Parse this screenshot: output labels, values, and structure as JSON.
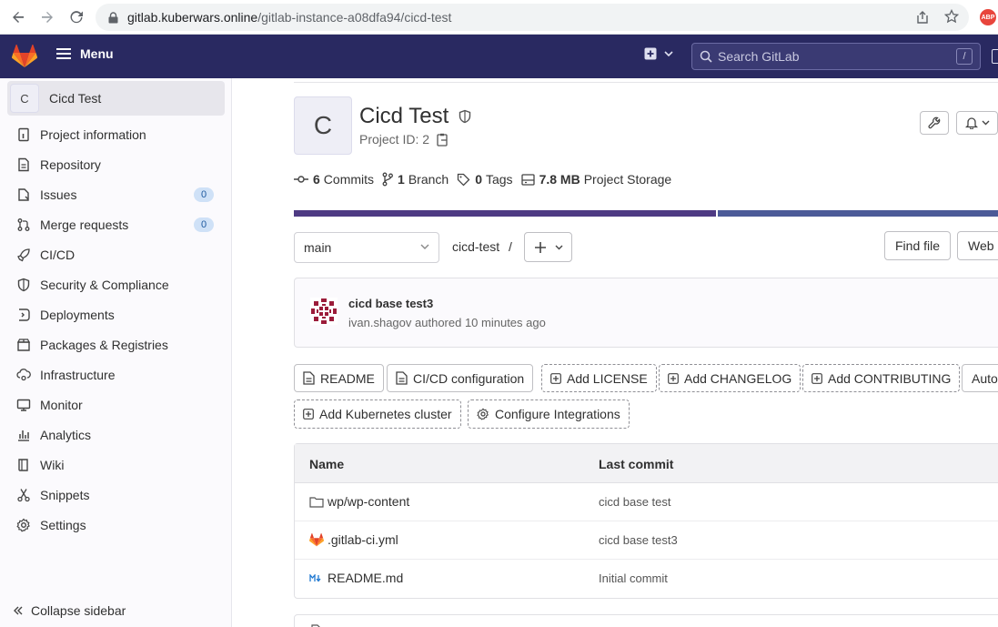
{
  "browser": {
    "url_host": "gitlab.kuberwars.online",
    "url_path": "/gitlab-instance-a08dfa94/cicd-test",
    "abp_label": "ABP"
  },
  "topnav": {
    "menu_label": "Menu",
    "search_placeholder": "Search GitLab",
    "search_shortcut": "/"
  },
  "sidebar": {
    "context_avatar": "C",
    "context_name": "Cicd Test",
    "items": [
      {
        "label": "Project information",
        "icon": "info-icon"
      },
      {
        "label": "Repository",
        "icon": "document-icon"
      },
      {
        "label": "Issues",
        "icon": "issues-icon",
        "count": "0"
      },
      {
        "label": "Merge requests",
        "icon": "merge-request-icon",
        "count": "0"
      },
      {
        "label": "CI/CD",
        "icon": "rocket-icon"
      },
      {
        "label": "Security & Compliance",
        "icon": "shield-icon"
      },
      {
        "label": "Deployments",
        "icon": "deployments-icon"
      },
      {
        "label": "Packages & Registries",
        "icon": "package-icon"
      },
      {
        "label": "Infrastructure",
        "icon": "cloud-gear-icon"
      },
      {
        "label": "Monitor",
        "icon": "monitor-icon"
      },
      {
        "label": "Analytics",
        "icon": "chart-icon"
      },
      {
        "label": "Wiki",
        "icon": "book-icon"
      },
      {
        "label": "Snippets",
        "icon": "scissors-icon"
      },
      {
        "label": "Settings",
        "icon": "gear-icon"
      }
    ],
    "collapse_label": "Collapse sidebar"
  },
  "project": {
    "avatar": "C",
    "title": "Cicd Test",
    "id_label": "Project ID: 2",
    "stats": {
      "commits_count": "6",
      "commits_label": "Commits",
      "branch_count": "1",
      "branch_label": "Branch",
      "tags_count": "0",
      "tags_label": "Tags",
      "storage_size": "7.8 MB",
      "storage_label": "Project Storage"
    }
  },
  "repo": {
    "branch": "main",
    "path": "cicd-test",
    "path_sep": "/",
    "find_file_label": "Find file",
    "web_ide_label": "Web"
  },
  "last_commit": {
    "title": "cicd base test3",
    "author": "ivan.shagov",
    "time_text": "authored 10 minutes ago"
  },
  "quick_actions": {
    "readme": "README",
    "cicd_config": "CI/CD configuration",
    "add_license": "Add LICENSE",
    "add_changelog": "Add CHANGELOG",
    "add_contributing": "Add CONTRIBUTING",
    "auto_devops": "Auto",
    "add_kubernetes": "Add Kubernetes cluster",
    "configure_integrations": "Configure Integrations"
  },
  "file_table": {
    "col_name": "Name",
    "col_last_commit": "Last commit",
    "rows": [
      {
        "name": "wp/wp-content",
        "commit": "cicd base test",
        "icon": "folder-icon"
      },
      {
        "name": ".gitlab-ci.yml",
        "commit": "cicd base test3",
        "icon": "gitlab-icon"
      },
      {
        "name": "README.md",
        "commit": "Initial commit",
        "icon": "markdown-icon"
      }
    ]
  },
  "colors": {
    "topnav_bg": "#292961",
    "language_bar_primary": "#4e3a83",
    "language_bar_secondary": "#4c5b98",
    "badge_bg": "#cfe1f7"
  }
}
